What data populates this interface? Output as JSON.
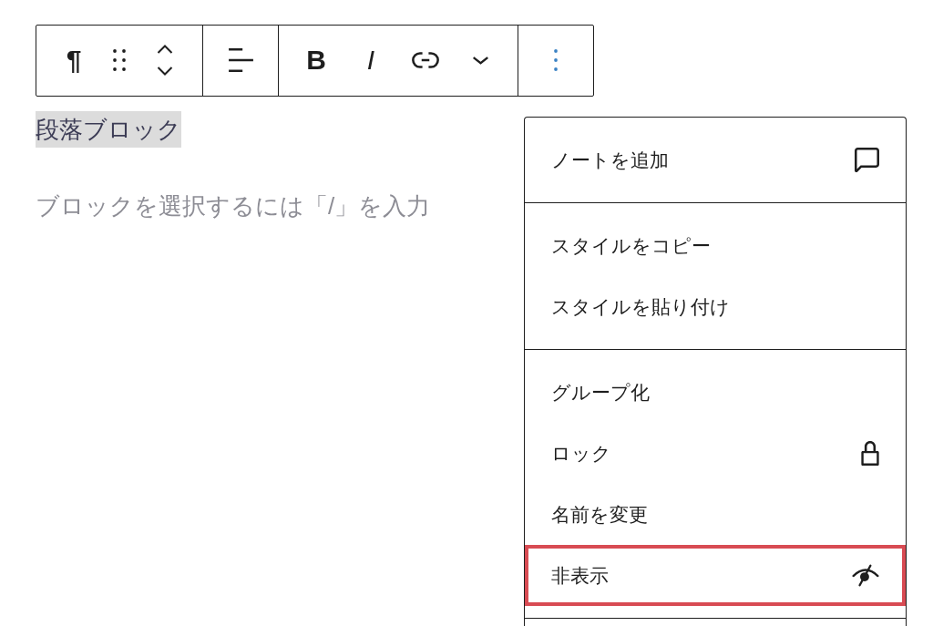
{
  "toolbar": {
    "groups": [
      {
        "buttons": [
          {
            "kind": "paragraph",
            "glyph": "¶",
            "expanded": false
          },
          {
            "kind": "drag",
            "expanded": false
          },
          {
            "kind": "move",
            "expanded": false
          }
        ]
      },
      {
        "buttons": [
          {
            "kind": "align",
            "expanded": false
          }
        ]
      },
      {
        "buttons": [
          {
            "kind": "bold",
            "glyph": "B",
            "expanded": false
          },
          {
            "kind": "italic",
            "glyph": "I",
            "expanded": false
          },
          {
            "kind": "link",
            "expanded": false
          },
          {
            "kind": "dropdown",
            "expanded": false
          }
        ]
      },
      {
        "buttons": [
          {
            "kind": "options",
            "expanded": true
          }
        ]
      }
    ]
  },
  "paragraph": {
    "text": "段落ブロック",
    "highlighted": true
  },
  "empty_block": {
    "placeholder": "ブロックを選択するには「/」を入力"
  },
  "options_menu": {
    "groups": [
      {
        "items": [
          {
            "kind": "note",
            "label": "ノートを追加",
            "highlighted": false
          }
        ]
      },
      {
        "items": [
          {
            "kind": "plain",
            "label": "スタイルをコピー",
            "highlighted": false
          },
          {
            "kind": "plain",
            "label": "スタイルを貼り付け",
            "highlighted": false
          }
        ]
      },
      {
        "items": [
          {
            "kind": "plain",
            "label": "グループ化",
            "highlighted": false
          },
          {
            "kind": "lock",
            "label": "ロック",
            "highlighted": false
          },
          {
            "kind": "plain",
            "label": "名前を変更",
            "highlighted": false
          },
          {
            "kind": "hide",
            "label": "非表示",
            "highlighted": true
          }
        ]
      }
    ]
  }
}
